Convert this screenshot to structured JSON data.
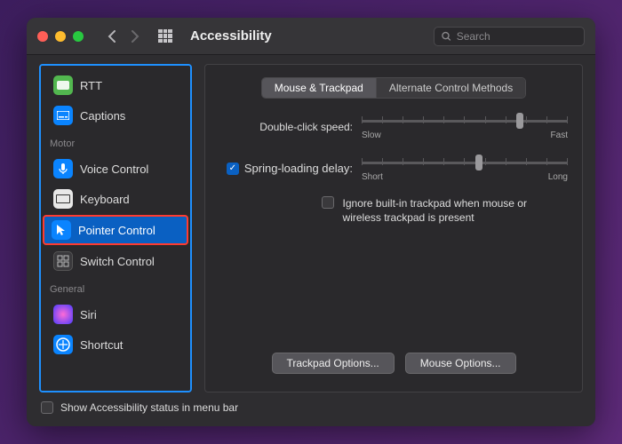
{
  "window": {
    "title": "Accessibility",
    "search_placeholder": "Search"
  },
  "sidebar": {
    "items_top": [
      {
        "label": "RTT",
        "icon": "rtt-icon"
      },
      {
        "label": "Captions",
        "icon": "captions-icon"
      }
    ],
    "group_motor": "Motor",
    "items_motor": [
      {
        "label": "Voice Control",
        "icon": "voice-icon"
      },
      {
        "label": "Keyboard",
        "icon": "keyboard-icon"
      },
      {
        "label": "Pointer Control",
        "icon": "pointer-icon",
        "selected": true
      },
      {
        "label": "Switch Control",
        "icon": "switch-icon"
      }
    ],
    "group_general": "General",
    "items_general": [
      {
        "label": "Siri",
        "icon": "siri-icon"
      },
      {
        "label": "Shortcut",
        "icon": "shortcut-icon"
      }
    ]
  },
  "content": {
    "tabs": [
      {
        "label": "Mouse & Trackpad",
        "active": true
      },
      {
        "label": "Alternate Control Methods",
        "active": false
      }
    ],
    "double_click": {
      "label": "Double-click speed:",
      "min_label": "Slow",
      "max_label": "Fast",
      "value_percent": 75
    },
    "spring_loading": {
      "checked": true,
      "label": "Spring-loading delay:",
      "min_label": "Short",
      "max_label": "Long",
      "value_percent": 55
    },
    "ignore_trackpad": {
      "checked": false,
      "label": "Ignore built-in trackpad when mouse or wireless trackpad is present"
    },
    "buttons": {
      "trackpad_options": "Trackpad Options...",
      "mouse_options": "Mouse Options..."
    }
  },
  "footer": {
    "checkbox_label": "Show Accessibility status in menu bar",
    "checked": false
  }
}
